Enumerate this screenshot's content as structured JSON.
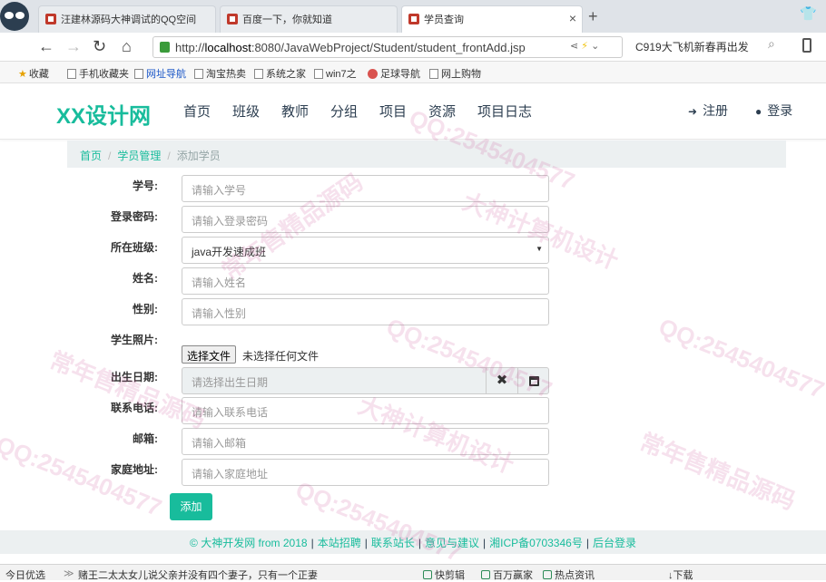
{
  "browser": {
    "tabs": [
      {
        "title": "汪建林源码大神调试的QQ空间",
        "active": false
      },
      {
        "title": "百度一下，你就知道",
        "active": false
      },
      {
        "title": "学员查询",
        "active": true
      }
    ],
    "new_tab": "+",
    "url_prefix": "http://",
    "url_host": "localhost",
    "url_rest": ":8080/JavaWebProject/Student/student_frontAdd.jsp",
    "search_hint": "C919大飞机新春再出发",
    "bookmarks": [
      "收藏",
      "手机收藏夹",
      "网址导航",
      "淘宝热卖",
      "系统之家",
      "win7之",
      "足球导航",
      "网上购物"
    ]
  },
  "site": {
    "brand": "XX设计网",
    "nav": [
      "首页",
      "班级",
      "教师",
      "分组",
      "项目",
      "资源",
      "项目日志"
    ],
    "register": "注册",
    "login": "登录"
  },
  "breadcrumb": {
    "home": "首页",
    "section": "学员管理",
    "current": "添加学员",
    "separator": "/"
  },
  "form": {
    "fields": [
      {
        "label": "学号:",
        "placeholder": "请输入学号"
      },
      {
        "label": "登录密码:",
        "placeholder": "请输入登录密码"
      },
      {
        "label": "所在班级:",
        "value": "java开发速成班"
      },
      {
        "label": "姓名:",
        "placeholder": "请输入姓名"
      },
      {
        "label": "性别:",
        "placeholder": "请输入性别"
      },
      {
        "label": "学生照片:"
      },
      {
        "label": "出生日期:",
        "placeholder": "请选择出生日期"
      },
      {
        "label": "联系电话:",
        "placeholder": "请输入联系电话"
      },
      {
        "label": "邮箱:",
        "placeholder": "请输入邮箱"
      },
      {
        "label": "家庭地址:",
        "placeholder": "请输入家庭地址"
      }
    ],
    "file_button": "选择文件",
    "file_status": "未选择任何文件",
    "date_clear": "✖",
    "submit": "添加"
  },
  "footer": {
    "copyright": "© 大神开发网 from 2018",
    "links": [
      "本站招聘",
      "联系站长",
      "意见与建议",
      "湘ICP备0703346号",
      "后台登录"
    ],
    "separator": "|"
  },
  "statusbar": {
    "left": "今日优选",
    "headline": "赌王二太太女儿说父亲并没有四个妻子，只有一个正妻",
    "items": [
      "快剪辑",
      "百万赢家",
      "热点资讯",
      "下载"
    ]
  },
  "watermarks": [
    "QQ:2545404577",
    "大神计算机设计",
    "常年售精品源码"
  ]
}
